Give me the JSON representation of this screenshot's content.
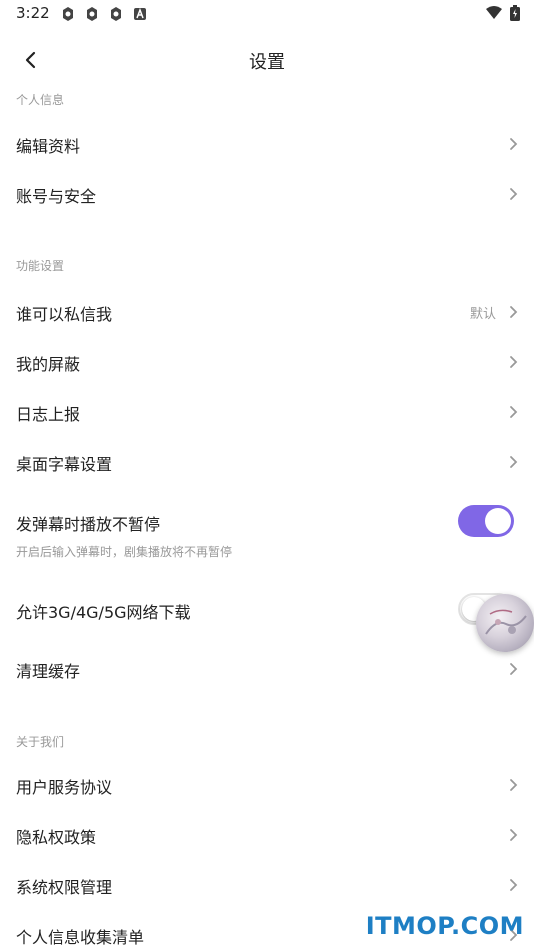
{
  "status_bar": {
    "time": "3:22"
  },
  "header": {
    "title": "设置"
  },
  "sections": {
    "personal": {
      "label": "个人信息",
      "items": [
        {
          "label": "编辑资料"
        },
        {
          "label": "账号与安全"
        }
      ]
    },
    "features": {
      "label": "功能设置",
      "private_message": {
        "label": "谁可以私信我",
        "value": "默认"
      },
      "blocked": {
        "label": "我的屏蔽"
      },
      "log_upload": {
        "label": "日志上报"
      },
      "desktop_subtitle": {
        "label": "桌面字幕设置"
      },
      "danmaku_no_pause": {
        "label": "发弹幕时播放不暂停",
        "description": "开启后输入弹幕时，剧集播放将不再暂停",
        "enabled": true
      },
      "mobile_download": {
        "label": "允许3G/4G/5G网络下载",
        "enabled": false
      },
      "clear_cache": {
        "label": "清理缓存"
      }
    },
    "about": {
      "label": "关于我们",
      "items": [
        {
          "label": "用户服务协议"
        },
        {
          "label": "隐私权政策"
        },
        {
          "label": "系统权限管理"
        },
        {
          "label": "个人信息收集清单"
        }
      ]
    }
  },
  "watermark": "ITMOP.COM",
  "colors": {
    "accent": "#8067e6",
    "secondary_text": "#999999",
    "watermark": "#1e7fc4"
  }
}
